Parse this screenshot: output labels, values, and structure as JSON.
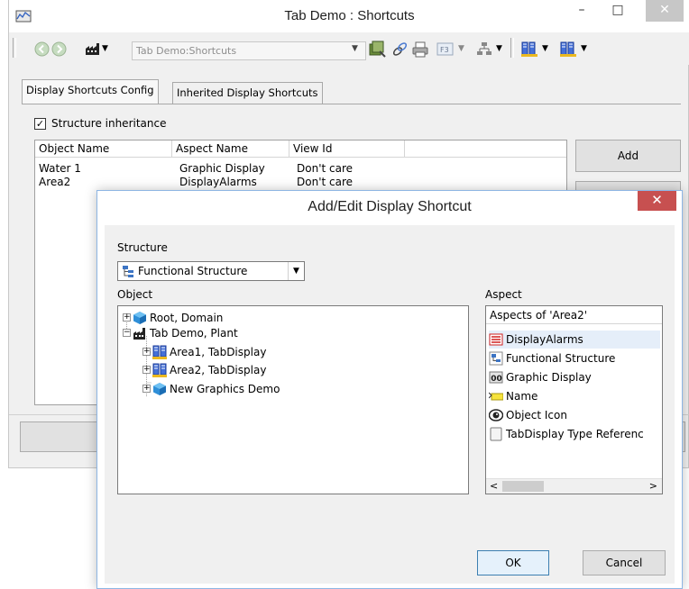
{
  "main_window": {
    "title": "Tab Demo : Shortcuts",
    "controls": {
      "minimize": "–",
      "maximize": "□",
      "close": "✕"
    },
    "address": "Tab Demo:Shortcuts",
    "tabs": [
      {
        "label": "Display Shortcuts Config",
        "active": true
      },
      {
        "label": "Inherited Display Shortcuts",
        "active": false
      }
    ],
    "structure_inheritance": {
      "label": "Structure inheritance",
      "checked": true
    },
    "list": {
      "columns": [
        "Object Name",
        "Aspect Name",
        "View Id"
      ],
      "rows": [
        [
          "Water 1",
          "Graphic Display",
          "Don't care"
        ],
        [
          "Area2",
          "DisplayAlarms",
          "Don't care"
        ]
      ]
    },
    "add_button": "Add"
  },
  "dialog": {
    "title": "Add/Edit Display Shortcut",
    "close": "✕",
    "structure_label": "Structure",
    "structure_value": "Functional Structure",
    "object_label": "Object",
    "tree": [
      {
        "label": "Root, Domain",
        "expander": "+",
        "icon": "cube-icon"
      },
      {
        "label": "Tab Demo, Plant",
        "expander": "−",
        "icon": "factory-icon"
      },
      {
        "label": "Area1, TabDisplay",
        "expander": "+",
        "icon": "tab-display-icon"
      },
      {
        "label": "Area2, TabDisplay",
        "expander": "+",
        "icon": "tab-display-icon"
      },
      {
        "label": "New Graphics Demo",
        "expander": "+",
        "icon": "cube-icon"
      }
    ],
    "aspect_label": "Aspect",
    "aspect_header": "Aspects of 'Area2'",
    "aspects": [
      {
        "label": "DisplayAlarms",
        "icon": "alarm-list-icon",
        "selected": true
      },
      {
        "label": "Functional Structure",
        "icon": "structure-icon",
        "selected": false
      },
      {
        "label": "Graphic Display",
        "icon": "graphic-display-icon",
        "selected": false
      },
      {
        "label": "Name",
        "icon": "name-tag-icon",
        "selected": false
      },
      {
        "label": "Object Icon",
        "icon": "eye-icon",
        "selected": false
      },
      {
        "label": "TabDisplay Type Referenc",
        "icon": "document-icon",
        "selected": false
      }
    ],
    "ok_button": "OK",
    "cancel_button": "Cancel"
  },
  "colors": {
    "dialog_close_bg": "#c75050",
    "selection_bg": "#e5eef9",
    "window_bg": "#f0f0f0"
  }
}
